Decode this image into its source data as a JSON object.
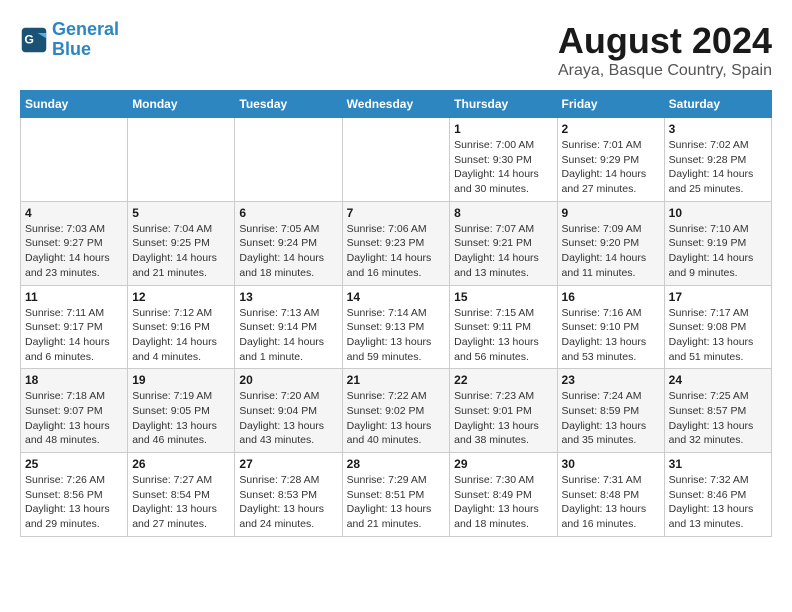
{
  "logo": {
    "line1": "General",
    "line2": "Blue"
  },
  "title": "August 2024",
  "location": "Araya, Basque Country, Spain",
  "weekdays": [
    "Sunday",
    "Monday",
    "Tuesday",
    "Wednesday",
    "Thursday",
    "Friday",
    "Saturday"
  ],
  "weeks": [
    [
      {
        "day": "",
        "info": ""
      },
      {
        "day": "",
        "info": ""
      },
      {
        "day": "",
        "info": ""
      },
      {
        "day": "",
        "info": ""
      },
      {
        "day": "1",
        "info": "Sunrise: 7:00 AM\nSunset: 9:30 PM\nDaylight: 14 hours and 30 minutes."
      },
      {
        "day": "2",
        "info": "Sunrise: 7:01 AM\nSunset: 9:29 PM\nDaylight: 14 hours and 27 minutes."
      },
      {
        "day": "3",
        "info": "Sunrise: 7:02 AM\nSunset: 9:28 PM\nDaylight: 14 hours and 25 minutes."
      }
    ],
    [
      {
        "day": "4",
        "info": "Sunrise: 7:03 AM\nSunset: 9:27 PM\nDaylight: 14 hours and 23 minutes."
      },
      {
        "day": "5",
        "info": "Sunrise: 7:04 AM\nSunset: 9:25 PM\nDaylight: 14 hours and 21 minutes."
      },
      {
        "day": "6",
        "info": "Sunrise: 7:05 AM\nSunset: 9:24 PM\nDaylight: 14 hours and 18 minutes."
      },
      {
        "day": "7",
        "info": "Sunrise: 7:06 AM\nSunset: 9:23 PM\nDaylight: 14 hours and 16 minutes."
      },
      {
        "day": "8",
        "info": "Sunrise: 7:07 AM\nSunset: 9:21 PM\nDaylight: 14 hours and 13 minutes."
      },
      {
        "day": "9",
        "info": "Sunrise: 7:09 AM\nSunset: 9:20 PM\nDaylight: 14 hours and 11 minutes."
      },
      {
        "day": "10",
        "info": "Sunrise: 7:10 AM\nSunset: 9:19 PM\nDaylight: 14 hours and 9 minutes."
      }
    ],
    [
      {
        "day": "11",
        "info": "Sunrise: 7:11 AM\nSunset: 9:17 PM\nDaylight: 14 hours and 6 minutes."
      },
      {
        "day": "12",
        "info": "Sunrise: 7:12 AM\nSunset: 9:16 PM\nDaylight: 14 hours and 4 minutes."
      },
      {
        "day": "13",
        "info": "Sunrise: 7:13 AM\nSunset: 9:14 PM\nDaylight: 14 hours and 1 minute."
      },
      {
        "day": "14",
        "info": "Sunrise: 7:14 AM\nSunset: 9:13 PM\nDaylight: 13 hours and 59 minutes."
      },
      {
        "day": "15",
        "info": "Sunrise: 7:15 AM\nSunset: 9:11 PM\nDaylight: 13 hours and 56 minutes."
      },
      {
        "day": "16",
        "info": "Sunrise: 7:16 AM\nSunset: 9:10 PM\nDaylight: 13 hours and 53 minutes."
      },
      {
        "day": "17",
        "info": "Sunrise: 7:17 AM\nSunset: 9:08 PM\nDaylight: 13 hours and 51 minutes."
      }
    ],
    [
      {
        "day": "18",
        "info": "Sunrise: 7:18 AM\nSunset: 9:07 PM\nDaylight: 13 hours and 48 minutes."
      },
      {
        "day": "19",
        "info": "Sunrise: 7:19 AM\nSunset: 9:05 PM\nDaylight: 13 hours and 46 minutes."
      },
      {
        "day": "20",
        "info": "Sunrise: 7:20 AM\nSunset: 9:04 PM\nDaylight: 13 hours and 43 minutes."
      },
      {
        "day": "21",
        "info": "Sunrise: 7:22 AM\nSunset: 9:02 PM\nDaylight: 13 hours and 40 minutes."
      },
      {
        "day": "22",
        "info": "Sunrise: 7:23 AM\nSunset: 9:01 PM\nDaylight: 13 hours and 38 minutes."
      },
      {
        "day": "23",
        "info": "Sunrise: 7:24 AM\nSunset: 8:59 PM\nDaylight: 13 hours and 35 minutes."
      },
      {
        "day": "24",
        "info": "Sunrise: 7:25 AM\nSunset: 8:57 PM\nDaylight: 13 hours and 32 minutes."
      }
    ],
    [
      {
        "day": "25",
        "info": "Sunrise: 7:26 AM\nSunset: 8:56 PM\nDaylight: 13 hours and 29 minutes."
      },
      {
        "day": "26",
        "info": "Sunrise: 7:27 AM\nSunset: 8:54 PM\nDaylight: 13 hours and 27 minutes."
      },
      {
        "day": "27",
        "info": "Sunrise: 7:28 AM\nSunset: 8:53 PM\nDaylight: 13 hours and 24 minutes."
      },
      {
        "day": "28",
        "info": "Sunrise: 7:29 AM\nSunset: 8:51 PM\nDaylight: 13 hours and 21 minutes."
      },
      {
        "day": "29",
        "info": "Sunrise: 7:30 AM\nSunset: 8:49 PM\nDaylight: 13 hours and 18 minutes."
      },
      {
        "day": "30",
        "info": "Sunrise: 7:31 AM\nSunset: 8:48 PM\nDaylight: 13 hours and 16 minutes."
      },
      {
        "day": "31",
        "info": "Sunrise: 7:32 AM\nSunset: 8:46 PM\nDaylight: 13 hours and 13 minutes."
      }
    ]
  ]
}
